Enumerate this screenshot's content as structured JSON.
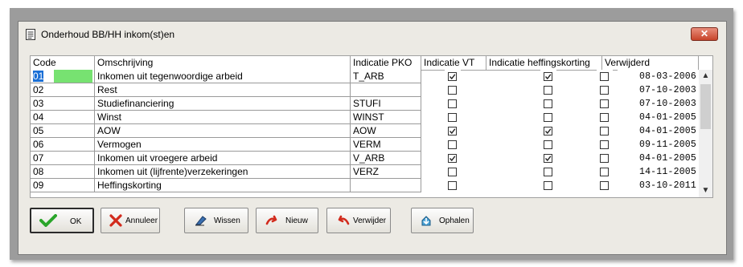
{
  "window": {
    "title": "Onderhoud BB/HH inkom(st)en",
    "close_label": "✕"
  },
  "grid": {
    "columns": [
      "Code",
      "Omschrijving",
      "Indicatie PKO",
      "Indicatie VT",
      "Indicatie heffingskorting",
      "Verwijderd"
    ],
    "rows": [
      {
        "code": "01",
        "omschrijving": "Inkomen uit tegenwoordige arbeid",
        "pko": "T_ARB",
        "vt": true,
        "hk": true,
        "verw": false,
        "date": "08-03-2006"
      },
      {
        "code": "02",
        "omschrijving": "Rest",
        "pko": "",
        "vt": false,
        "hk": false,
        "verw": false,
        "date": "07-10-2003"
      },
      {
        "code": "03",
        "omschrijving": "Studiefinanciering",
        "pko": "STUFI",
        "vt": false,
        "hk": false,
        "verw": false,
        "date": "07-10-2003"
      },
      {
        "code": "04",
        "omschrijving": "Winst",
        "pko": "WINST",
        "vt": false,
        "hk": false,
        "verw": false,
        "date": "04-01-2005"
      },
      {
        "code": "05",
        "omschrijving": "AOW",
        "pko": "AOW",
        "vt": true,
        "hk": true,
        "verw": false,
        "date": "04-01-2005"
      },
      {
        "code": "06",
        "omschrijving": "Vermogen",
        "pko": "VERM",
        "vt": false,
        "hk": false,
        "verw": false,
        "date": "09-11-2005"
      },
      {
        "code": "07",
        "omschrijving": "Inkomen uit vroegere arbeid",
        "pko": "V_ARB",
        "vt": true,
        "hk": true,
        "verw": false,
        "date": "04-01-2005"
      },
      {
        "code": "08",
        "omschrijving": "Inkomen uit (lijfrente)verzekeringen",
        "pko": "VERZ",
        "vt": false,
        "hk": false,
        "verw": false,
        "date": "14-11-2005"
      },
      {
        "code": "09",
        "omschrijving": "Heffingskorting",
        "pko": "",
        "vt": false,
        "hk": false,
        "verw": false,
        "date": "03-10-2011"
      }
    ]
  },
  "buttons": {
    "ok": "OK",
    "annuleer": "Annuleer",
    "wissen": "Wissen",
    "nieuw": "Nieuw",
    "verwijder": "Verwijder",
    "ophalen": "Ophalen"
  },
  "colors": {
    "selected": "#1a6fd6",
    "highlight_green": "#77e271",
    "ok_check": "#2aa52a",
    "red_icon": "#d22b1d"
  }
}
